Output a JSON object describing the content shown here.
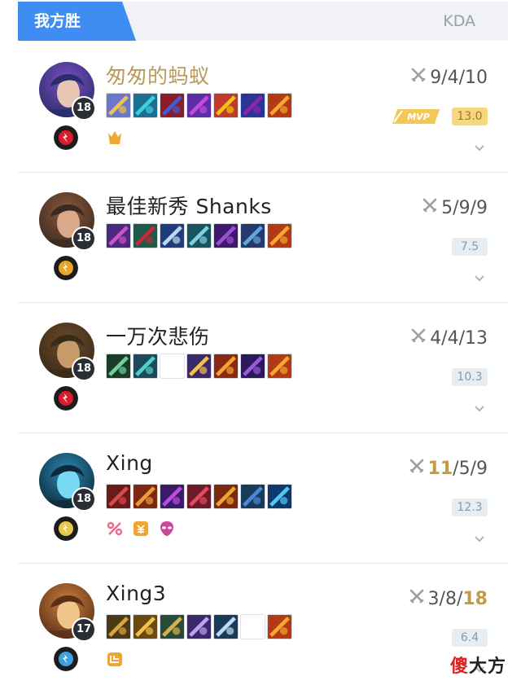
{
  "header": {
    "tab_label": "我方胜",
    "kda_label": "KDA"
  },
  "players": [
    {
      "name": "匆匆的蚂蚁",
      "gold_name": true,
      "level": "18",
      "kda_prefix": "9/4/10",
      "kda_hi": "",
      "kda_suffix": "",
      "score": "13.0",
      "mvp": true,
      "avatar_colors": [
        "#2b2d6a",
        "#7a4fc4",
        "#e9c6b3"
      ],
      "spell": "#d91c2a",
      "items": [
        "#6b78c9|#f2c14e",
        "#1d6e8f|#3fd0e0",
        "#8a1d2a|#3f5bd8",
        "#5a2ea8|#c84ad9",
        "#c0392b|#f1c40f",
        "#283593|#8e24aa",
        "#b23a14|#f7a531"
      ],
      "badges": [
        "crown-icon"
      ]
    },
    {
      "name": "最佳新秀 Shanks",
      "gold_name": false,
      "level": "18",
      "kda_prefix": "5/9/9",
      "kda_hi": "",
      "kda_suffix": "",
      "score": "7.5",
      "mvp": false,
      "avatar_colors": [
        "#3a2a20",
        "#8b5a3c",
        "#d9a98a"
      ],
      "spell": "#e8a524",
      "items": [
        "#4a2a7a|#d04fd0",
        "#1e5a4a|#c02a3a",
        "#1f3d7a|#bcd8f2",
        "#18535e|#7fd0e0",
        "#3d1a6b|#9c4fd9",
        "#253a6b|#5fa8d9",
        "#b23a14|#f7a531"
      ],
      "badges": []
    },
    {
      "name": "一万次悲伤",
      "gold_name": false,
      "level": "18",
      "kda_prefix": "4/4/13",
      "kda_hi": "",
      "kda_suffix": "",
      "score": "10.3",
      "mvp": false,
      "avatar_colors": [
        "#3a2a18",
        "#6b4a2a",
        "#c79a6a"
      ],
      "spell": "#d91c2a",
      "items": [
        "#1a3d2a|#6fd19a",
        "#1d4a5a|#4fd0c8",
        "",
        "#3a2a6b|#f2c14e",
        "#8a2a14|#f2a531",
        "#2a1a5a|#9a5ad9",
        "#b23a14|#f7a531"
      ],
      "badges": []
    },
    {
      "name": "Xing",
      "gold_name": false,
      "level": "18",
      "kda_prefix": "",
      "kda_hi": "11",
      "kda_suffix": "/5/9",
      "score": "12.3",
      "mvp": false,
      "avatar_colors": [
        "#0e2a3a",
        "#2a8ab4",
        "#7ad9f2"
      ],
      "spell": "#e8c84a",
      "items": [
        "#6b1a1a|#d84a4a",
        "#7a2a10|#f29a3a",
        "#3a1a6b|#c04ad9",
        "#6b1a2a|#e04a5a",
        "#7a2a10|#f2a531",
        "#1a3a5a|#4a8ad9",
        "#0e3a6b|#4fc8f2"
      ],
      "badges": [
        "scissors-icon",
        "coin-icon",
        "alien-icon"
      ]
    },
    {
      "name": "Xing3",
      "gold_name": false,
      "level": "17",
      "kda_prefix": "3/8/",
      "kda_hi": "18",
      "kda_suffix": "",
      "score": "6.4",
      "mvp": false,
      "avatar_colors": [
        "#5a3018",
        "#c9803a",
        "#f2c48a"
      ],
      "spell": "#3fa0e0",
      "items": [
        "#4a3a18|#d9a53a",
        "#6b4a10|#f2c14e",
        "#2a4a3a|#d9b04a",
        "#3a2a6b|#c0a0f2",
        "#1a3a5a|#c0d8f2",
        "",
        "#b23a14|#f7a531"
      ],
      "badges": [
        "flag-icon"
      ]
    }
  ],
  "watermark": {
    "red": "傻",
    "black": "大方"
  },
  "colors": {
    "accent": "#3f8df3",
    "gold": "#c39a47",
    "mvp_bg": "#f6d77d"
  }
}
